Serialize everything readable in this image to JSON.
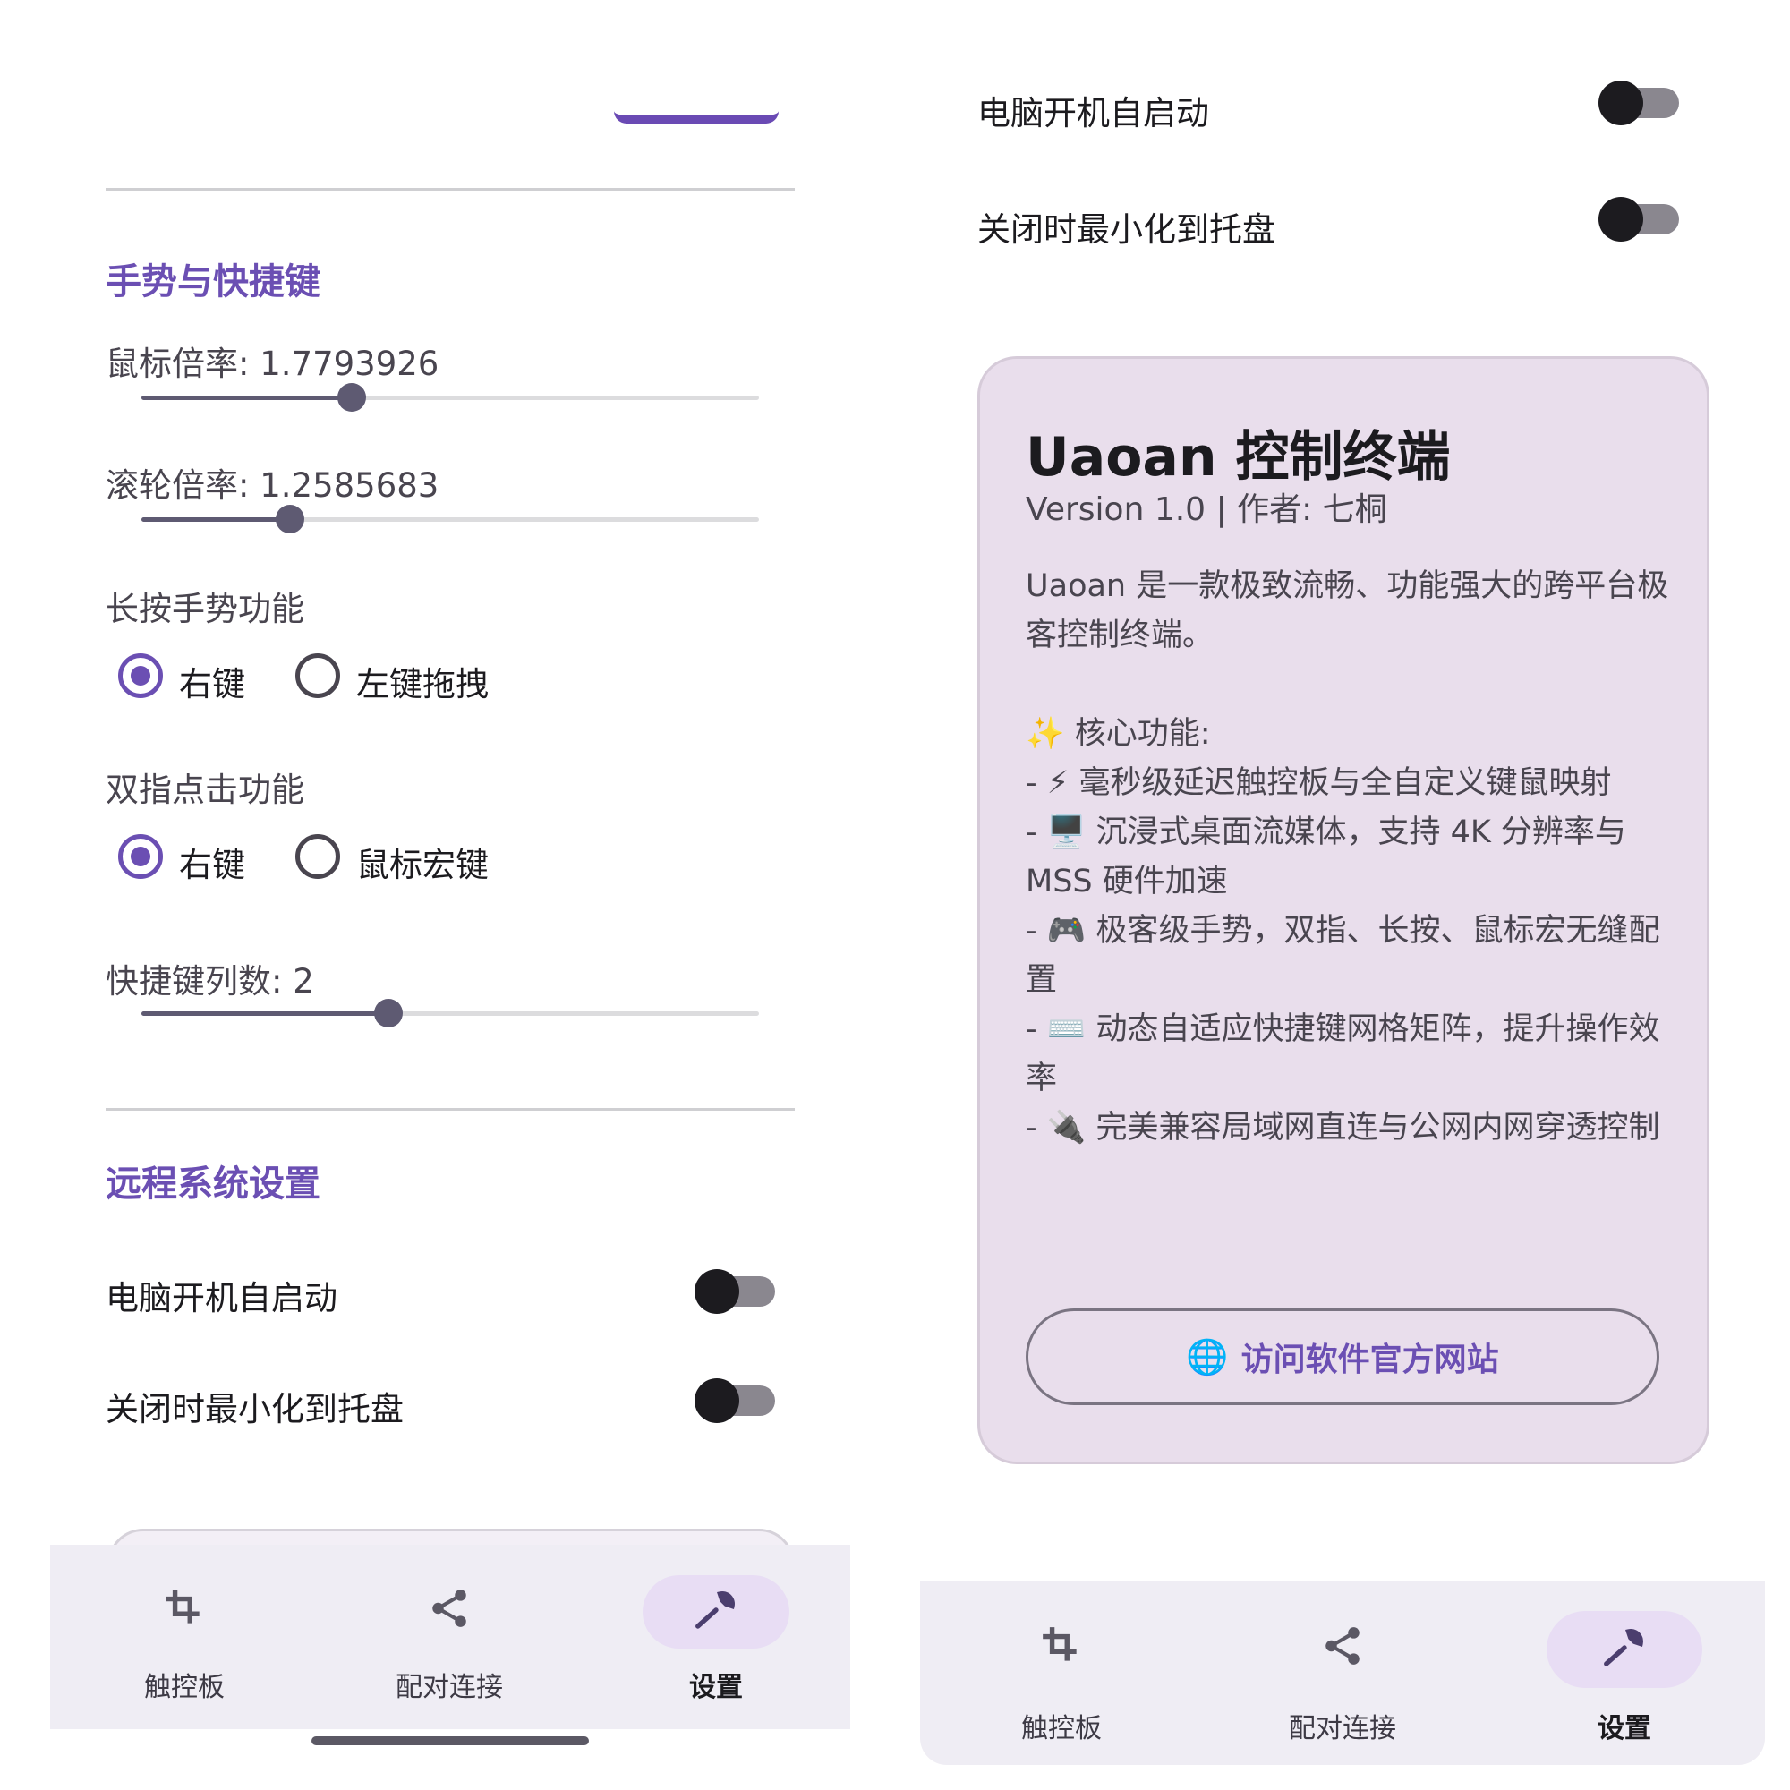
{
  "colors": {
    "accent": "#6b4fb3",
    "nav_active_pill": "#e8ddf4",
    "card_bg": "#e9deec"
  },
  "left": {
    "gestures": {
      "title": "手势与快捷键",
      "mouse_rate": {
        "label": "鼠标倍率: 1.7793926",
        "value": 1.7793926,
        "fraction": 0.34
      },
      "scroll_rate": {
        "label": "滚轮倍率: 1.2585683",
        "value": 1.2585683,
        "fraction": 0.24
      },
      "long_press": {
        "label": "长按手势功能",
        "options": [
          "右键",
          "左键拖拽"
        ],
        "selected": "右键"
      },
      "two_finger": {
        "label": "双指点击功能",
        "options": [
          "右键",
          "鼠标宏键"
        ],
        "selected": "右键"
      },
      "shortcut_cols": {
        "label": "快捷键列数: 2",
        "value": 2,
        "fraction": 0.4
      }
    },
    "remote": {
      "title": "远程系统设置",
      "autostart_label": "电脑开机自启动",
      "autostart_on": false,
      "minimize_label": "关闭时最小化到托盘",
      "minimize_on": false
    },
    "nav": {
      "items": [
        {
          "label": "触控板",
          "icon": "crop-icon"
        },
        {
          "label": "配对连接",
          "icon": "share-icon"
        },
        {
          "label": "设置",
          "icon": "wrench-icon",
          "active": true
        }
      ]
    }
  },
  "right": {
    "autostart_label": "电脑开机自启动",
    "autostart_on": false,
    "minimize_label": "关闭时最小化到托盘",
    "minimize_on": false,
    "about": {
      "title": "Uaoan 控制终端",
      "version": "Version 1.0 | 作者: 七桐",
      "intro": "Uaoan 是一款极致流畅、功能强大的跨平台极客控制终端。",
      "features_heading": "✨ 核心功能:",
      "features": [
        "- ⚡ 毫秒级延迟触控板与全自定义键鼠映射",
        "- 🖥️ 沉浸式桌面流媒体，支持 4K 分辨率与 MSS 硬件加速",
        "- 🎮 极客级手势，双指、长按、鼠标宏无缝配置",
        "- ⌨️ 动态自适应快捷键网格矩阵，提升操作效率",
        "- 🔌 完美兼容局域网直连与公网内网穿透控制"
      ],
      "button_icon": "🌐",
      "button_label": "访问软件官方网站"
    },
    "nav": {
      "items": [
        {
          "label": "触控板",
          "icon": "crop-icon"
        },
        {
          "label": "配对连接",
          "icon": "share-icon"
        },
        {
          "label": "设置",
          "icon": "wrench-icon",
          "active": true
        }
      ]
    }
  }
}
